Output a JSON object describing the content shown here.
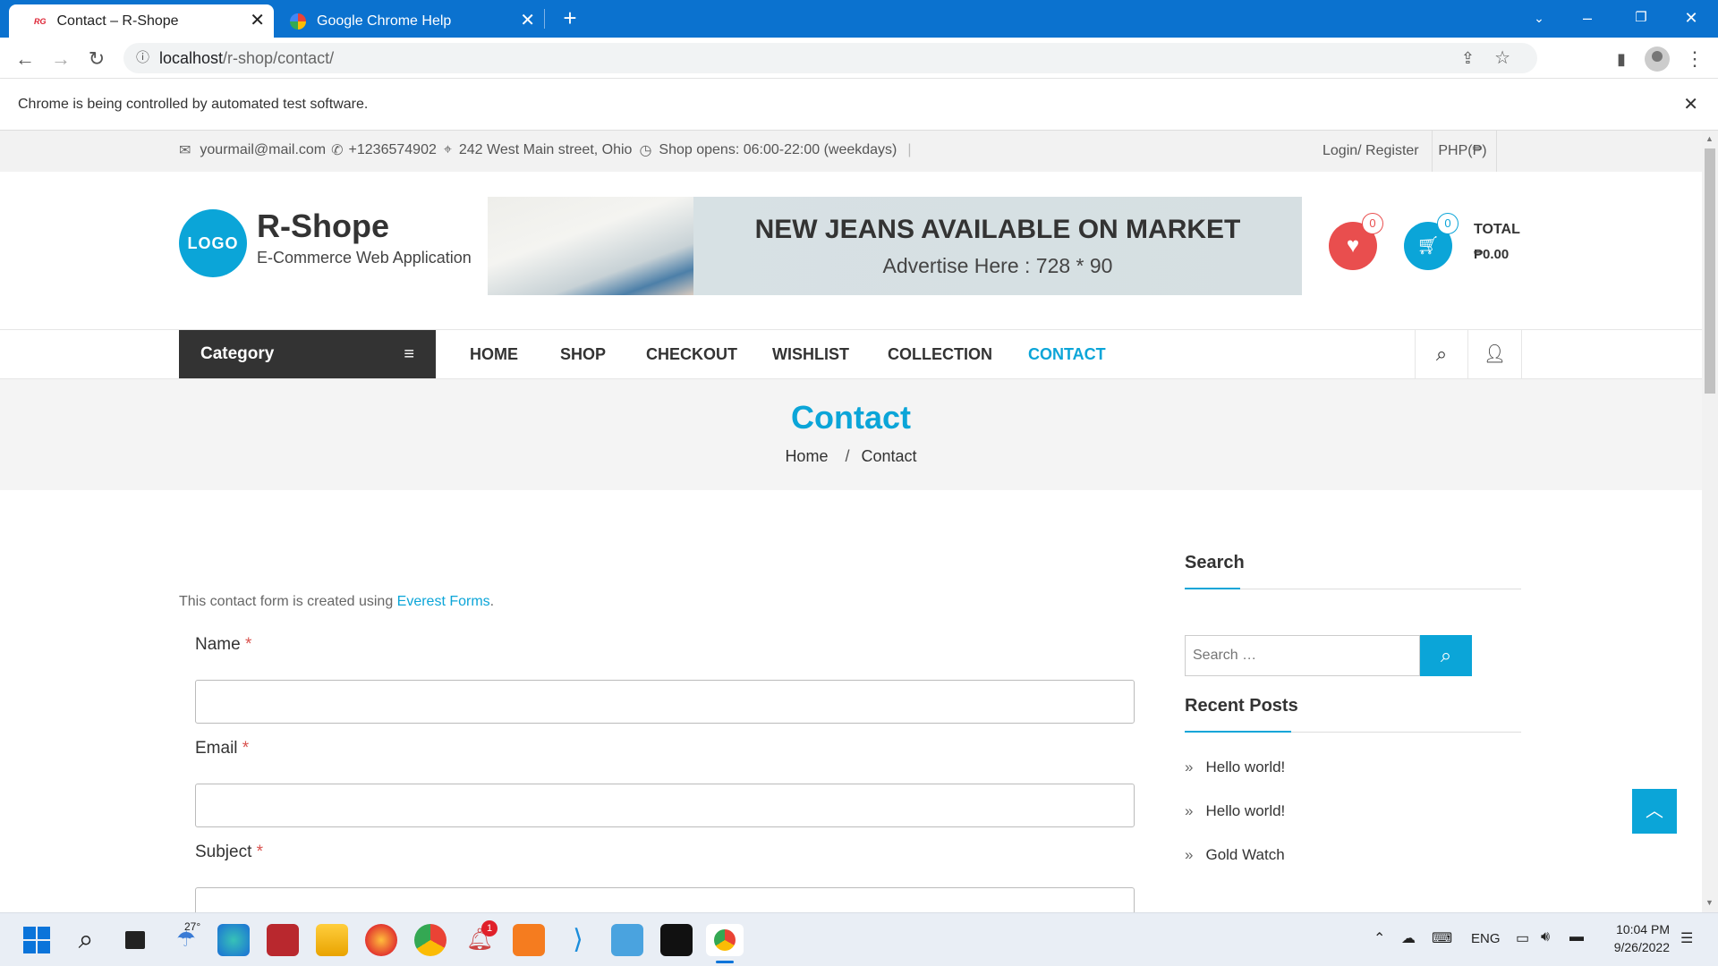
{
  "browser": {
    "tabs": [
      {
        "title": "Contact – R-Shope",
        "favicon_text": "RG"
      },
      {
        "title": "Google Chrome Help"
      }
    ],
    "url_host": "localhost",
    "url_path": "/r-shop/contact/",
    "infobar_text": "Chrome is being controlled by automated test software."
  },
  "topbar": {
    "email": "yourmail@mail.com",
    "phone": "+1236574902",
    "address": "242 West Main street, Ohio",
    "hours": "Shop opens: 06:00-22:00 (weekdays)",
    "login": "Login/ Register",
    "currency": "PHP(₱)"
  },
  "header": {
    "logo_text": "LOGO",
    "site_title": "R-Shope",
    "tagline": "E-Commerce Web Application",
    "ad_headline": "NEW JEANS AVAILABLE ON MARKET",
    "ad_sub": "Advertise Here : 728 * 90",
    "wishlist_count": "0",
    "cart_count": "0",
    "total_label": "TOTAL",
    "total_value": "₱0.00"
  },
  "nav": {
    "category_label": "Category",
    "items": [
      "HOME",
      "SHOP",
      "CHECKOUT",
      "WISHLIST",
      "COLLECTION",
      "CONTACT"
    ],
    "active": "CONTACT"
  },
  "page_banner": {
    "title": "Contact",
    "breadcrumb_home": "Home",
    "breadcrumb_sep": "/",
    "breadcrumb_current": "Contact"
  },
  "form": {
    "intro_prefix": "This contact form is created using ",
    "intro_link": "Everest Forms",
    "intro_suffix": ".",
    "fields": [
      {
        "label": "Name",
        "required": "*"
      },
      {
        "label": "Email",
        "required": "*"
      },
      {
        "label": "Subject",
        "required": "*"
      }
    ]
  },
  "sidebar": {
    "search_title": "Search",
    "search_placeholder": "Search …",
    "recent_title": "Recent Posts",
    "posts": [
      "Hello world!",
      "Hello world!",
      "Gold Watch"
    ]
  },
  "taskbar": {
    "weather": "27°",
    "notification_badge": "1",
    "language": "ENG",
    "time": "10:04 PM",
    "date": "9/26/2022"
  },
  "colors": {
    "accent": "#0ba5d8",
    "titlebar": "#0b72cf",
    "wishlist_red": "#e94e4e",
    "dark": "#333333"
  }
}
